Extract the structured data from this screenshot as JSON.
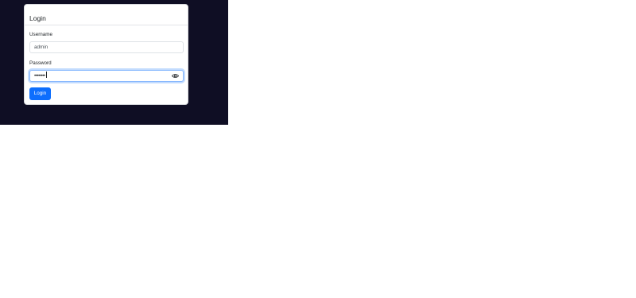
{
  "login_card": {
    "title": "Login",
    "username_label": "Username",
    "username_value": "admin",
    "password_label": "Password",
    "password_masked": "••••••••",
    "submit_label": "Login"
  },
  "colors": {
    "background": "#0f0e24",
    "primary": "#0d6efd",
    "focus_border": "#86b7fe"
  },
  "icons": {
    "toggle_visibility": "eye-icon"
  }
}
